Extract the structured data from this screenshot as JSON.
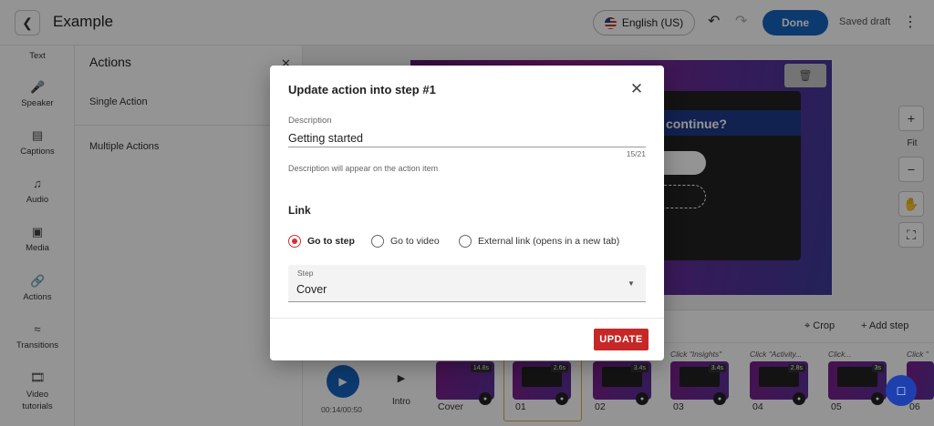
{
  "header": {
    "title": "Example",
    "language": "English (US)",
    "done_label": "Done",
    "saved_label": "Saved draft"
  },
  "sidebar": {
    "items": [
      {
        "label": "Text",
        "icon": "text-icon"
      },
      {
        "label": "Speaker",
        "icon": "microphone-icon"
      },
      {
        "label": "Captions",
        "icon": "captions-icon"
      },
      {
        "label": "Audio",
        "icon": "music-note-icon"
      },
      {
        "label": "Media",
        "icon": "image-icon"
      },
      {
        "label": "Actions",
        "icon": "link-icon",
        "active": true
      },
      {
        "label": "Transitions",
        "icon": "transitions-icon"
      },
      {
        "label": "Video tutorials",
        "icon": "film-icon"
      }
    ]
  },
  "actions_panel": {
    "title": "Actions",
    "rows": [
      "Single Action",
      "Multiple Actions"
    ]
  },
  "timeline": {
    "crop_label": "Crop",
    "add_step_label": "Add step",
    "time": "00:14/00:50",
    "intro_label": "Intro",
    "steps": [
      {
        "label": "Cover",
        "duration": "14.8s",
        "click_text": ""
      },
      {
        "label": "01",
        "duration": "2.6s",
        "click_text": ""
      },
      {
        "label": "02",
        "duration": "3.4s",
        "click_text": ""
      },
      {
        "label": "03",
        "duration": "3.4s",
        "click_text": "Click \"Insights\""
      },
      {
        "label": "04",
        "duration": "2.8s",
        "click_text": "Click \"Activity..."
      },
      {
        "label": "05",
        "duration": "3s",
        "click_text": "Click..."
      },
      {
        "label": "06",
        "duration": "",
        "click_text": "Click \""
      }
    ]
  },
  "canvas": {
    "question_text": "continue?",
    "fit_label": "Fit"
  },
  "dialog": {
    "title": "Update action into step #1",
    "description_label": "Description",
    "description_value": "Getting started",
    "counter": "15/21",
    "helper": "Description will appear on the action item",
    "link_heading": "Link",
    "radio_options": [
      {
        "label": "Go to step",
        "checked": true
      },
      {
        "label": "Go to video",
        "checked": false
      },
      {
        "label": "External link (opens in a new tab)",
        "checked": false
      }
    ],
    "step_label": "Step",
    "step_value": "Cover",
    "update_label": "UPDATE"
  },
  "colors": {
    "primary": "#1565c0",
    "danger": "#c62828",
    "radio_active": "#d32f2f"
  }
}
